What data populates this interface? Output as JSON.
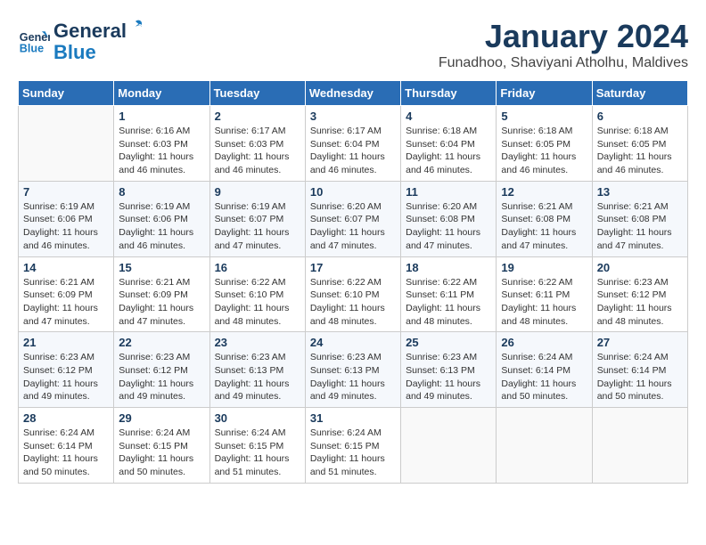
{
  "header": {
    "logo_general": "General",
    "logo_blue": "Blue",
    "month": "January 2024",
    "location": "Funadhoo, Shaviyani Atholhu, Maldives"
  },
  "weekdays": [
    "Sunday",
    "Monday",
    "Tuesday",
    "Wednesday",
    "Thursday",
    "Friday",
    "Saturday"
  ],
  "weeks": [
    [
      {
        "day": "",
        "info": ""
      },
      {
        "day": "1",
        "info": "Sunrise: 6:16 AM\nSunset: 6:03 PM\nDaylight: 11 hours and 46 minutes."
      },
      {
        "day": "2",
        "info": "Sunrise: 6:17 AM\nSunset: 6:03 PM\nDaylight: 11 hours and 46 minutes."
      },
      {
        "day": "3",
        "info": "Sunrise: 6:17 AM\nSunset: 6:04 PM\nDaylight: 11 hours and 46 minutes."
      },
      {
        "day": "4",
        "info": "Sunrise: 6:18 AM\nSunset: 6:04 PM\nDaylight: 11 hours and 46 minutes."
      },
      {
        "day": "5",
        "info": "Sunrise: 6:18 AM\nSunset: 6:05 PM\nDaylight: 11 hours and 46 minutes."
      },
      {
        "day": "6",
        "info": "Sunrise: 6:18 AM\nSunset: 6:05 PM\nDaylight: 11 hours and 46 minutes."
      }
    ],
    [
      {
        "day": "7",
        "info": "Sunrise: 6:19 AM\nSunset: 6:06 PM\nDaylight: 11 hours and 46 minutes."
      },
      {
        "day": "8",
        "info": "Sunrise: 6:19 AM\nSunset: 6:06 PM\nDaylight: 11 hours and 46 minutes."
      },
      {
        "day": "9",
        "info": "Sunrise: 6:19 AM\nSunset: 6:07 PM\nDaylight: 11 hours and 47 minutes."
      },
      {
        "day": "10",
        "info": "Sunrise: 6:20 AM\nSunset: 6:07 PM\nDaylight: 11 hours and 47 minutes."
      },
      {
        "day": "11",
        "info": "Sunrise: 6:20 AM\nSunset: 6:08 PM\nDaylight: 11 hours and 47 minutes."
      },
      {
        "day": "12",
        "info": "Sunrise: 6:21 AM\nSunset: 6:08 PM\nDaylight: 11 hours and 47 minutes."
      },
      {
        "day": "13",
        "info": "Sunrise: 6:21 AM\nSunset: 6:08 PM\nDaylight: 11 hours and 47 minutes."
      }
    ],
    [
      {
        "day": "14",
        "info": "Sunrise: 6:21 AM\nSunset: 6:09 PM\nDaylight: 11 hours and 47 minutes."
      },
      {
        "day": "15",
        "info": "Sunrise: 6:21 AM\nSunset: 6:09 PM\nDaylight: 11 hours and 47 minutes."
      },
      {
        "day": "16",
        "info": "Sunrise: 6:22 AM\nSunset: 6:10 PM\nDaylight: 11 hours and 48 minutes."
      },
      {
        "day": "17",
        "info": "Sunrise: 6:22 AM\nSunset: 6:10 PM\nDaylight: 11 hours and 48 minutes."
      },
      {
        "day": "18",
        "info": "Sunrise: 6:22 AM\nSunset: 6:11 PM\nDaylight: 11 hours and 48 minutes."
      },
      {
        "day": "19",
        "info": "Sunrise: 6:22 AM\nSunset: 6:11 PM\nDaylight: 11 hours and 48 minutes."
      },
      {
        "day": "20",
        "info": "Sunrise: 6:23 AM\nSunset: 6:12 PM\nDaylight: 11 hours and 48 minutes."
      }
    ],
    [
      {
        "day": "21",
        "info": "Sunrise: 6:23 AM\nSunset: 6:12 PM\nDaylight: 11 hours and 49 minutes."
      },
      {
        "day": "22",
        "info": "Sunrise: 6:23 AM\nSunset: 6:12 PM\nDaylight: 11 hours and 49 minutes."
      },
      {
        "day": "23",
        "info": "Sunrise: 6:23 AM\nSunset: 6:13 PM\nDaylight: 11 hours and 49 minutes."
      },
      {
        "day": "24",
        "info": "Sunrise: 6:23 AM\nSunset: 6:13 PM\nDaylight: 11 hours and 49 minutes."
      },
      {
        "day": "25",
        "info": "Sunrise: 6:23 AM\nSunset: 6:13 PM\nDaylight: 11 hours and 49 minutes."
      },
      {
        "day": "26",
        "info": "Sunrise: 6:24 AM\nSunset: 6:14 PM\nDaylight: 11 hours and 50 minutes."
      },
      {
        "day": "27",
        "info": "Sunrise: 6:24 AM\nSunset: 6:14 PM\nDaylight: 11 hours and 50 minutes."
      }
    ],
    [
      {
        "day": "28",
        "info": "Sunrise: 6:24 AM\nSunset: 6:14 PM\nDaylight: 11 hours and 50 minutes."
      },
      {
        "day": "29",
        "info": "Sunrise: 6:24 AM\nSunset: 6:15 PM\nDaylight: 11 hours and 50 minutes."
      },
      {
        "day": "30",
        "info": "Sunrise: 6:24 AM\nSunset: 6:15 PM\nDaylight: 11 hours and 51 minutes."
      },
      {
        "day": "31",
        "info": "Sunrise: 6:24 AM\nSunset: 6:15 PM\nDaylight: 11 hours and 51 minutes."
      },
      {
        "day": "",
        "info": ""
      },
      {
        "day": "",
        "info": ""
      },
      {
        "day": "",
        "info": ""
      }
    ]
  ]
}
